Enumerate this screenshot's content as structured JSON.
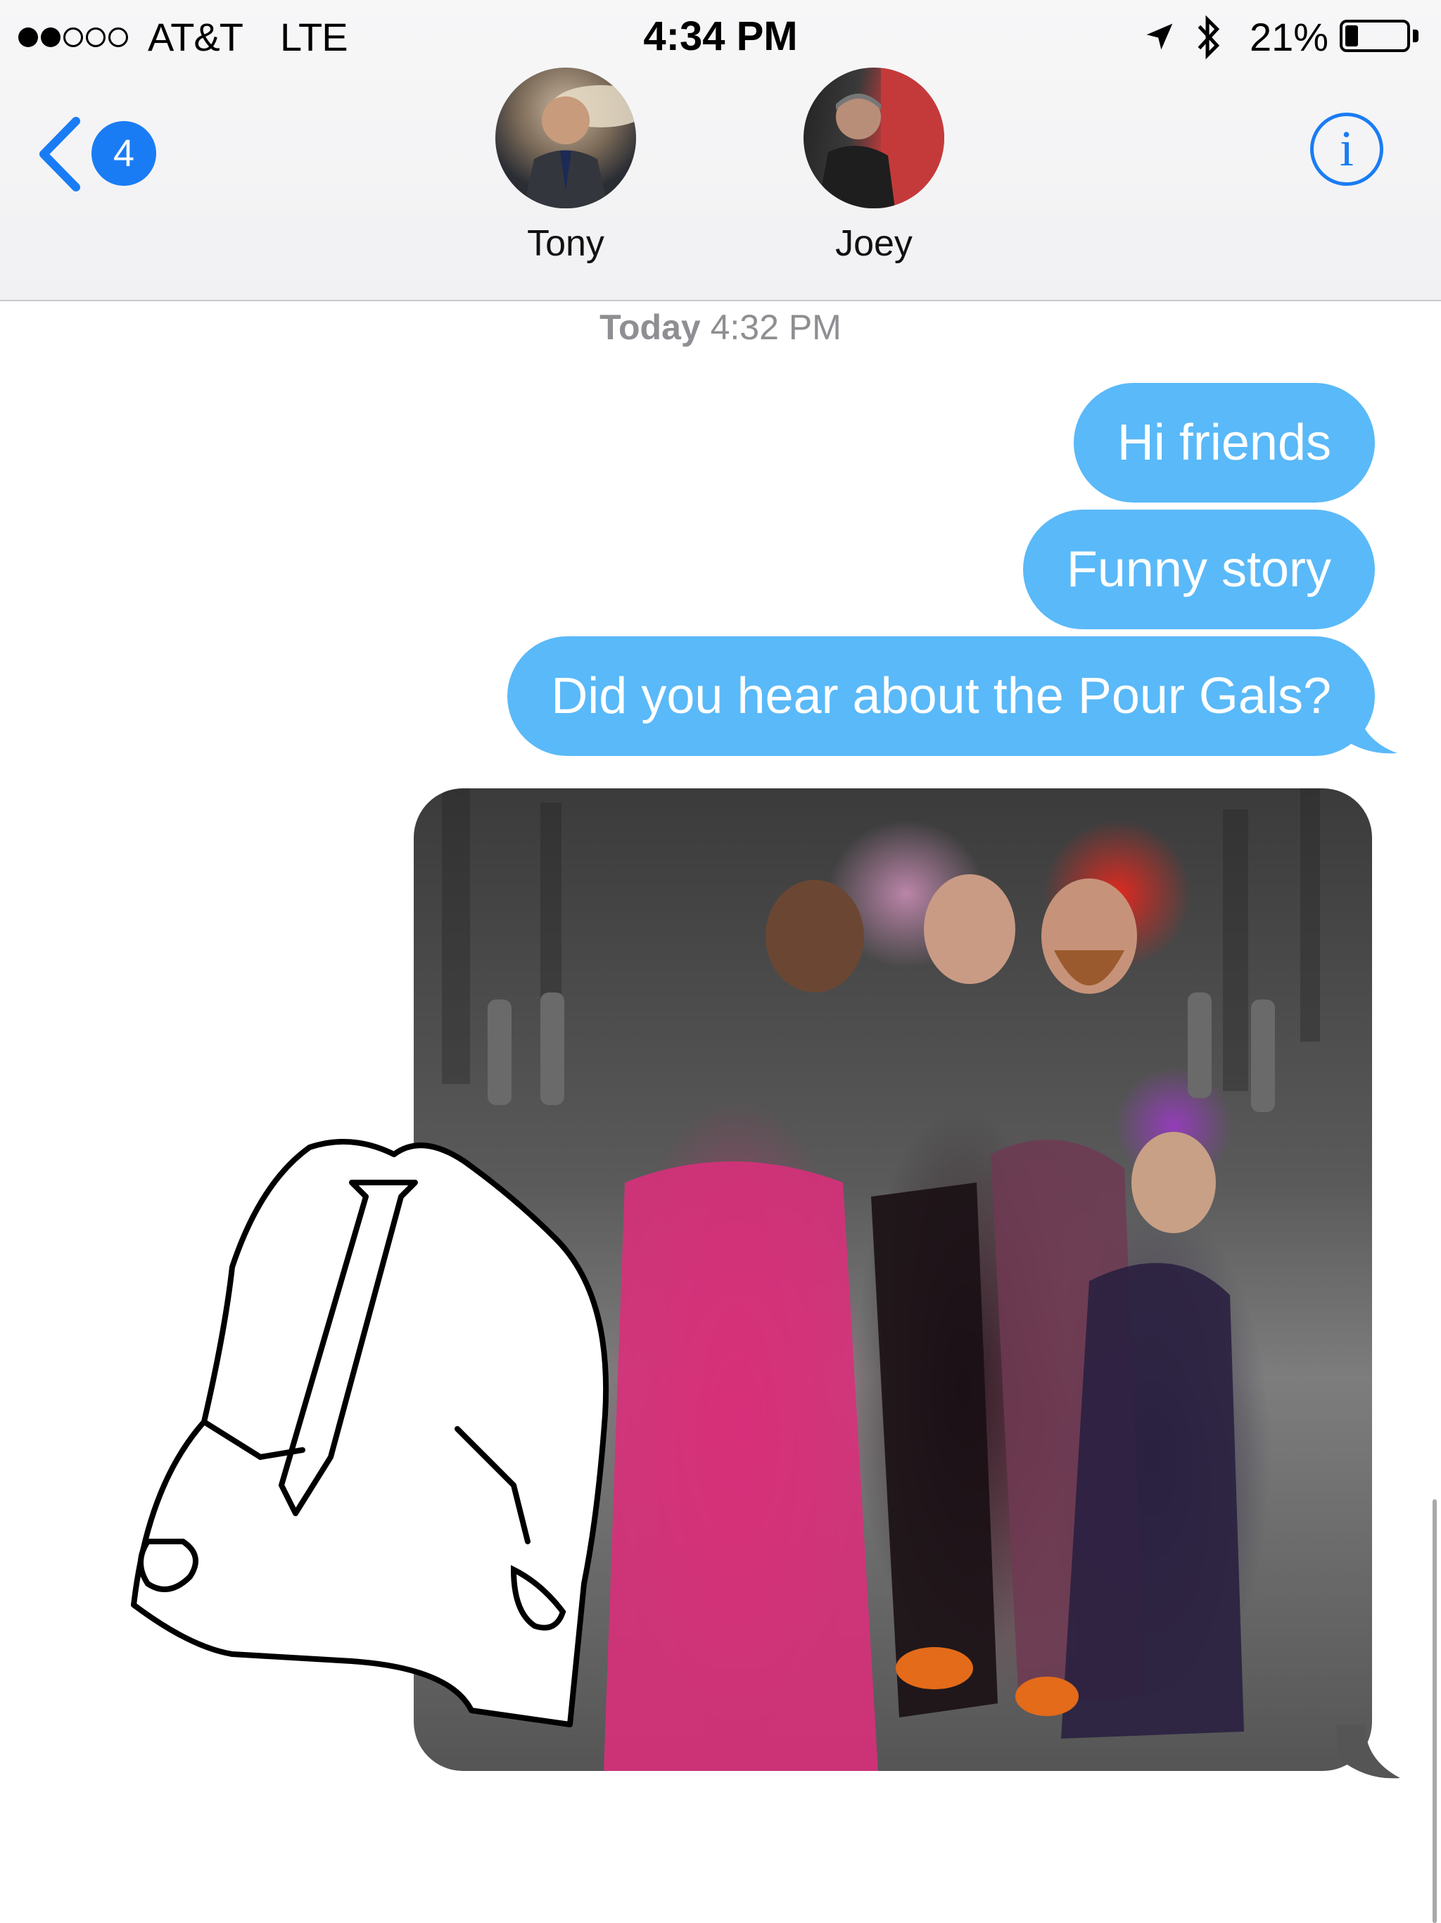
{
  "status_bar": {
    "signal_bars_filled": 2,
    "signal_bars_total": 5,
    "carrier": "AT&T",
    "network": "LTE",
    "time": "4:34 PM",
    "battery_percent_label": "21%",
    "battery_level": 0.21,
    "icons": [
      "location-arrow-icon",
      "bluetooth-icon",
      "battery-icon"
    ]
  },
  "header": {
    "back_badge_count": "4",
    "contacts": [
      {
        "name": "Tony"
      },
      {
        "name": "Joey"
      }
    ],
    "info_glyph": "i"
  },
  "conversation": {
    "timestamp_day": "Today",
    "timestamp_time": "4:32 PM",
    "messages": [
      {
        "text": "Hi friends"
      },
      {
        "text": "Funny story"
      },
      {
        "text": "Did you hear about the Pour Gals?"
      }
    ]
  },
  "colors": {
    "accent_blue": "#1a7cf4",
    "bubble_blue": "#5ab9f8",
    "timestamp_gray": "#8e8e93"
  }
}
